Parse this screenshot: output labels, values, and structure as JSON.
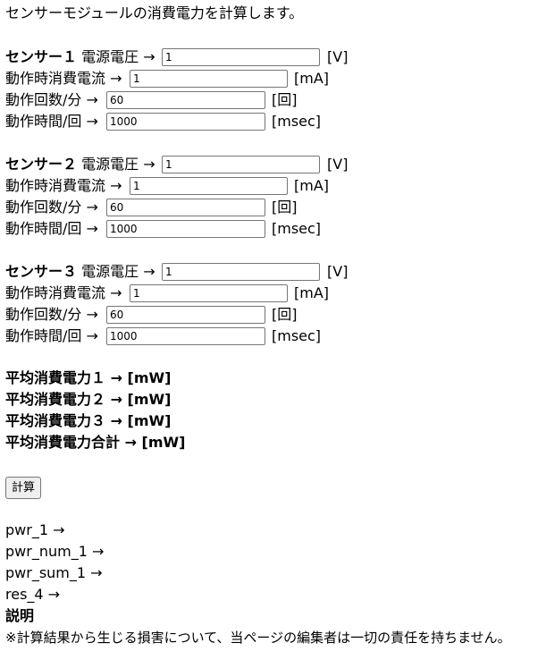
{
  "intro": "センサーモジュールの消費電力を計算します。",
  "sensors": [
    {
      "title": "センサー１",
      "voltage_label": " 電源電圧 →",
      "current_label": "動作時消費電流 →",
      "count_label": "動作回数/分 →",
      "time_label": "動作時間/回 →",
      "voltage_value": "1",
      "current_value": "1",
      "count_value": "60",
      "time_value": "1000",
      "voltage_unit": "[V]",
      "current_unit": "[mA]",
      "count_unit": "[回]",
      "time_unit": "[msec]"
    },
    {
      "title": "センサー２",
      "voltage_label": " 電源電圧 →",
      "current_label": "動作時消費電流 →",
      "count_label": "動作回数/分 →",
      "time_label": "動作時間/回 →",
      "voltage_value": "1",
      "current_value": "1",
      "count_value": "60",
      "time_value": "1000",
      "voltage_unit": "[V]",
      "current_unit": "[mA]",
      "count_unit": "[回]",
      "time_unit": "[msec]"
    },
    {
      "title": "センサー３",
      "voltage_label": " 電源電圧 →",
      "current_label": "動作時消費電流 →",
      "count_label": "動作回数/分 →",
      "time_label": "動作時間/回 →",
      "voltage_value": "1",
      "current_value": "1",
      "count_value": "60",
      "time_value": "1000",
      "voltage_unit": "[V]",
      "current_unit": "[mA]",
      "count_unit": "[回]",
      "time_unit": "[msec]"
    }
  ],
  "results": {
    "avg1": "平均消費電力１ → [mW]",
    "avg2": "平均消費電力２ → [mW]",
    "avg3": "平均消費電力３ → [mW]",
    "total": "平均消費電力合計 → [mW]"
  },
  "calc_button_label": "計算",
  "debug": {
    "pwr_1": "pwr_1 →",
    "pwr_num_1": "pwr_num_1 →",
    "pwr_sum_1": "pwr_sum_1 →",
    "res_4": "res_4 →"
  },
  "notes": {
    "heading": "説明",
    "disclaimer": "※計算結果から生じる損害について、当ページの編集者は一切の責任を持ちません。"
  }
}
